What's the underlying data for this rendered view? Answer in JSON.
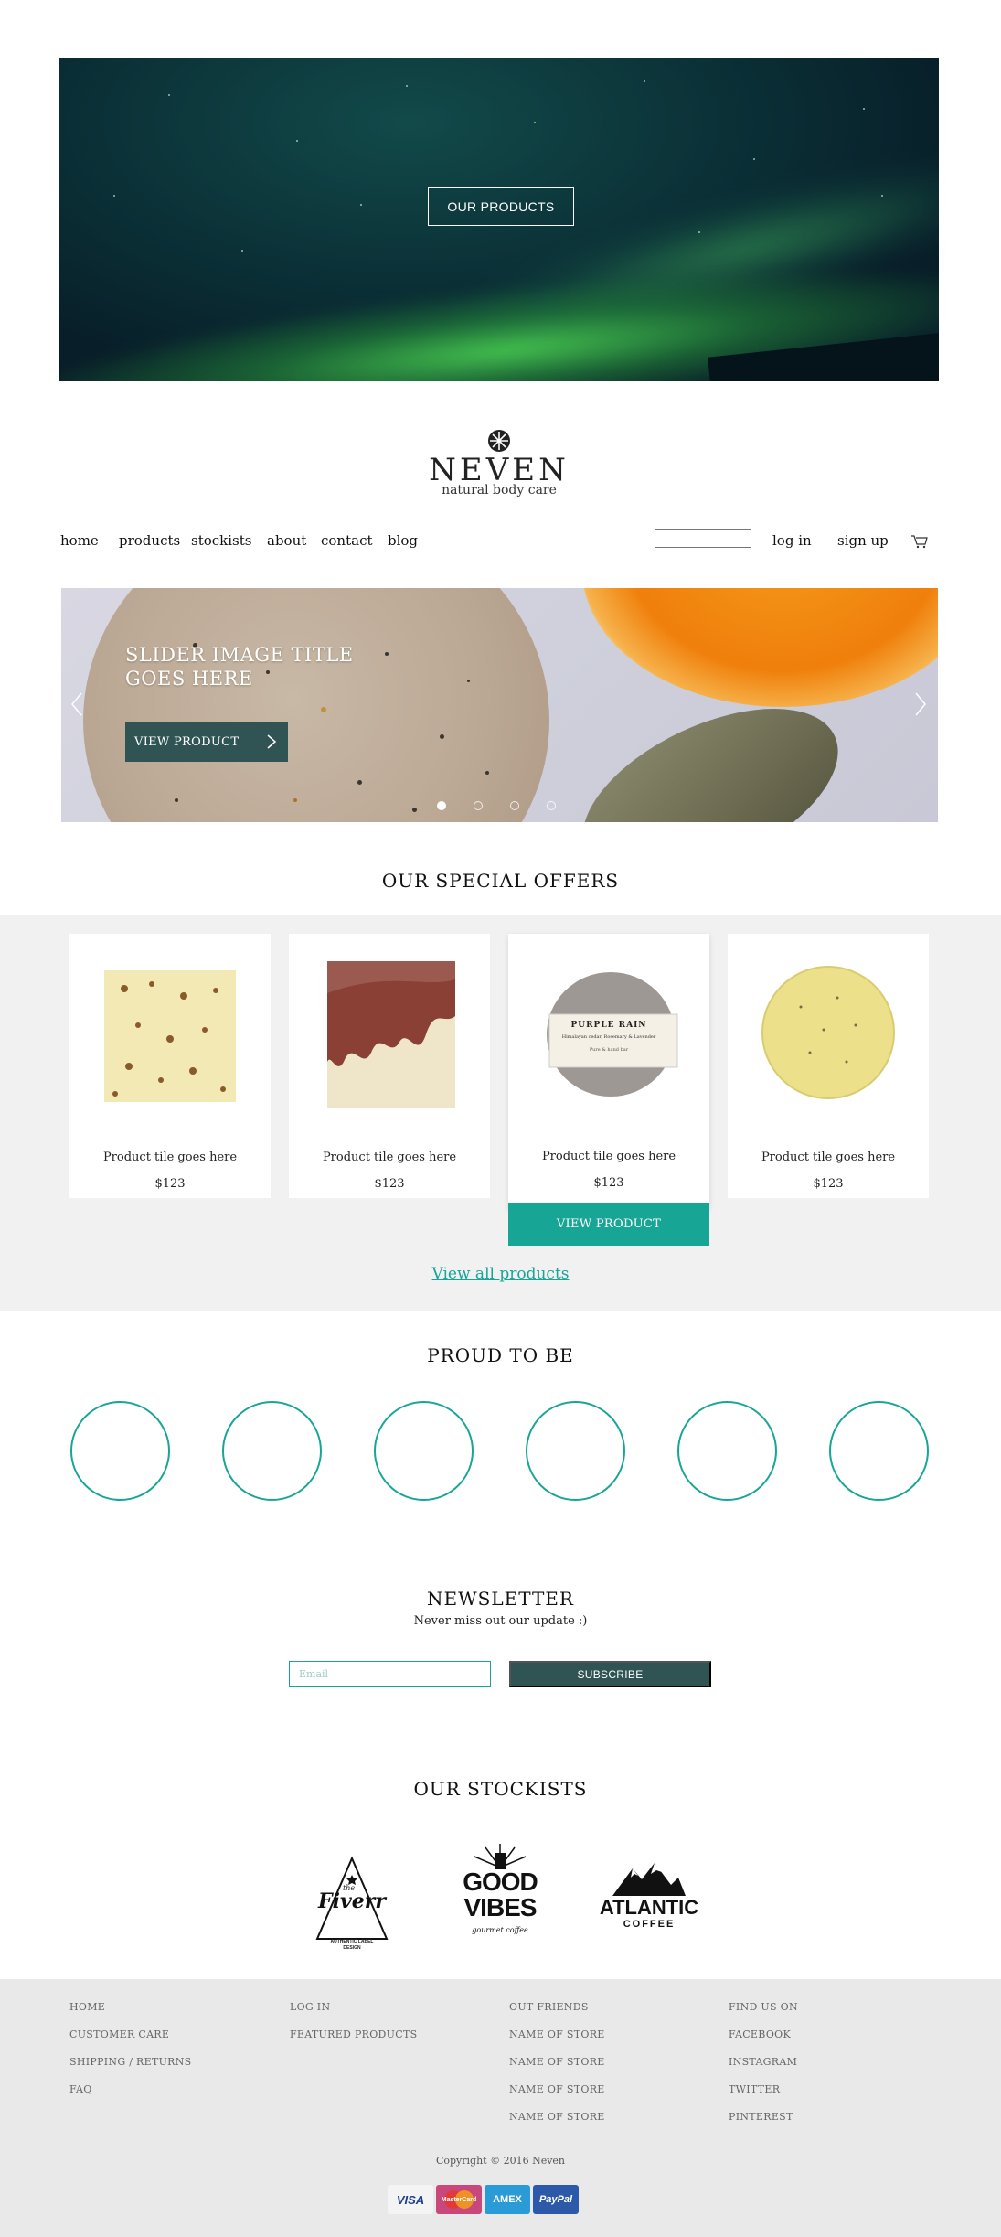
{
  "hero": {
    "button_label": "OUR PRODUCTS"
  },
  "brand": {
    "name": "NEVEN",
    "tagline": "natural body care"
  },
  "nav": {
    "links": [
      "home",
      "products",
      "stockists",
      "about",
      "contact",
      "blog"
    ],
    "login": "log in",
    "signup": "sign up"
  },
  "slider": {
    "title": "SLIDER IMAGE TITLE GOES HERE",
    "button": "VIEW PRODUCT",
    "dots": 4,
    "active_dot": 1
  },
  "offers": {
    "title": "OUR SPECIAL OFFERS",
    "products": [
      {
        "title": "Product tile goes here",
        "price": "$123"
      },
      {
        "title": "Product tile goes here",
        "price": "$123"
      },
      {
        "title": "Product tile goes here",
        "price": "$123",
        "label": "PURPLE RAIN",
        "label_sub": "Himalayan cedar, Rosemary & Lavender",
        "label_foot": "Pure & hand bar"
      },
      {
        "title": "Product tile goes here",
        "price": "$123"
      }
    ],
    "hover_button": "VIEW PRODUCT",
    "view_all": "View all products"
  },
  "proud": {
    "title": "PROUD TO BE",
    "count": 6
  },
  "newsletter": {
    "title": "NEWSLETTER",
    "subtitle": "Never miss out our update :)",
    "placeholder": "Email",
    "button": "SUBSCRIBE"
  },
  "stockists": {
    "title": "OUR STOCKISTS",
    "logos": [
      {
        "name": "Fiverr",
        "small": "the",
        "sub": "AUTHENTIC LABEL DESIGN"
      },
      {
        "name": "GOOD VIBES",
        "line1": "GOOD",
        "line2": "VIBES",
        "sub": "gourmet coffee"
      },
      {
        "name": "ATLANTIC",
        "line1": "ATLANTIC",
        "line2": "COFFEE"
      }
    ]
  },
  "footer": {
    "col1": [
      "HOME",
      "CUSTOMER CARE",
      "SHIPPING / RETURNS",
      "FAQ"
    ],
    "col2": [
      "LOG IN",
      "FEATURED PRODUCTS"
    ],
    "col3": [
      "OUT FRIENDS",
      "NAME OF STORE",
      "NAME OF STORE",
      "NAME OF STORE",
      "NAME OF STORE"
    ],
    "col4": [
      "FIND US ON",
      "FACEBOOK",
      "INSTAGRAM",
      "TWITTER",
      "PINTEREST"
    ],
    "copyright": "Copyright ©  2016 Neven",
    "payments": [
      "VISA",
      "MasterCard",
      "AMEX",
      "PayPal"
    ]
  },
  "colors": {
    "accent": "#17a595",
    "dark_teal": "#2f5453",
    "offers_bg": "#f1f1f1",
    "footer_bg": "#e9e9e9"
  }
}
